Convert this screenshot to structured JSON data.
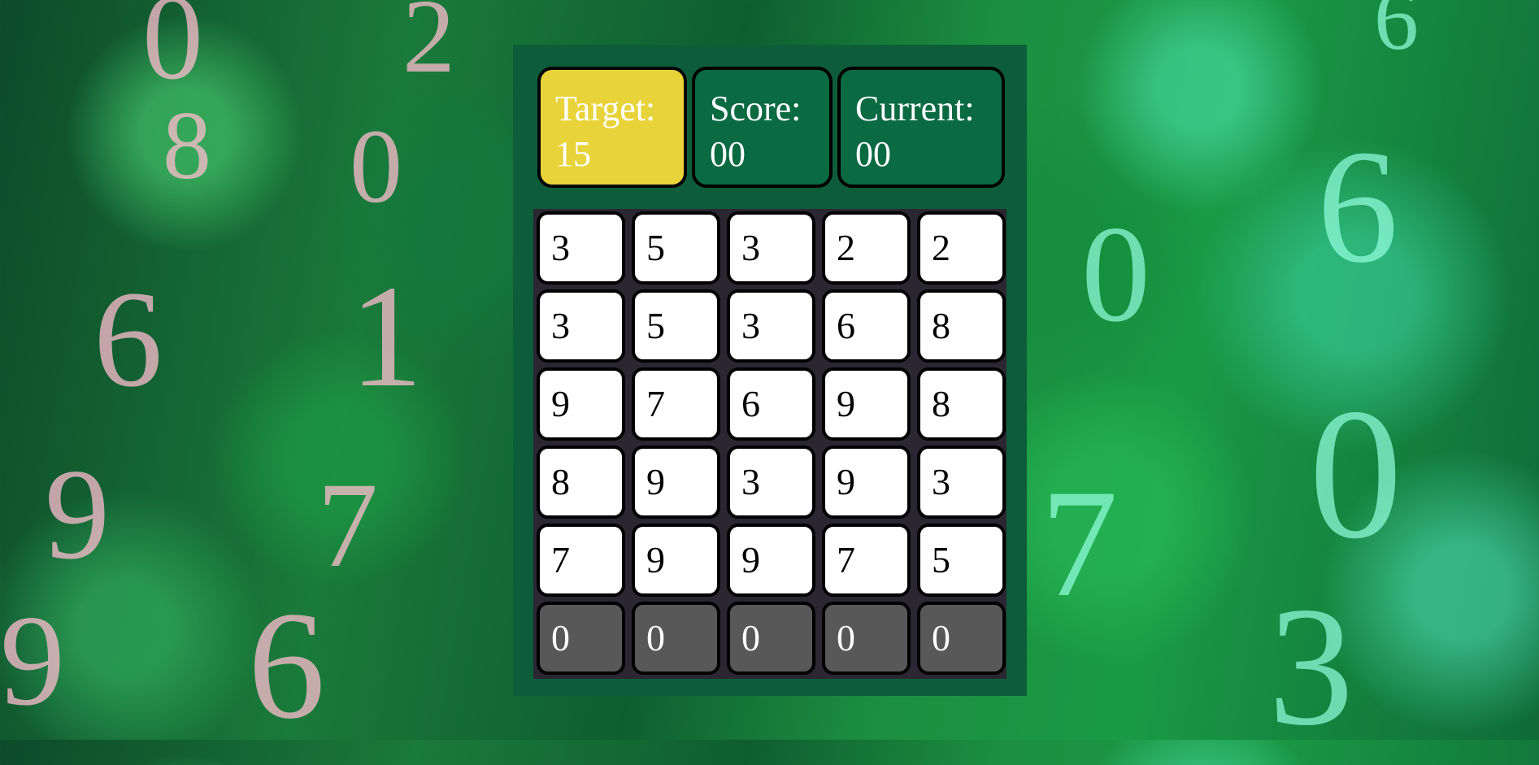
{
  "stats": {
    "target_label": "Target:",
    "target_value": "15",
    "score_label": "Score:",
    "score_value": "00",
    "current_label": "Current:",
    "current_value": "00"
  },
  "grid": [
    [
      "3",
      "5",
      "3",
      "2",
      "2"
    ],
    [
      "3",
      "5",
      "3",
      "6",
      "8"
    ],
    [
      "9",
      "7",
      "6",
      "9",
      "8"
    ],
    [
      "8",
      "9",
      "3",
      "9",
      "3"
    ],
    [
      "7",
      "9",
      "9",
      "7",
      "5"
    ]
  ],
  "bottom_row": [
    "0",
    "0",
    "0",
    "0",
    "0"
  ],
  "colors": {
    "panel": "#0d5d3a",
    "target_box": "#e8d33a",
    "stat_box": "#0a6a42",
    "cell": "#ffffff",
    "bottom_cell": "#585858",
    "grid_bg": "#2a2732"
  }
}
